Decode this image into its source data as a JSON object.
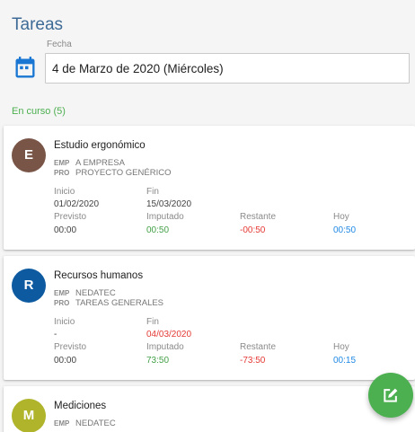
{
  "header": {
    "title": "Tareas"
  },
  "date_picker": {
    "label": "Fecha",
    "value": "4 de Marzo de 2020 (Miércoles)"
  },
  "section": {
    "label": "En curso (5)"
  },
  "labels": {
    "emp": "EMP",
    "pro": "PRO",
    "start": "Inicio",
    "end": "Fin",
    "planned": "Previsto",
    "charged": "Imputado",
    "remaining": "Restante",
    "today": "Hoy"
  },
  "tasks": [
    {
      "initial": "E",
      "avatar_color": "#795548",
      "title": "Estudio ergonómico",
      "company": "A EMPRESA",
      "project": "PROYECTO GENÉRICO",
      "start": "01/02/2020",
      "end": "15/03/2020",
      "planned": "00:00",
      "charged": "00:50",
      "remaining": "-00:50",
      "today": "00:50"
    },
    {
      "initial": "R",
      "avatar_color": "#0d5aa0",
      "title": "Recursos humanos",
      "company": "NEDATEC",
      "project": "TAREAS GENERALES",
      "start": "-",
      "end": "04/03/2020",
      "planned": "00:00",
      "charged": "73:50",
      "remaining": "-73:50",
      "today": "00:15"
    },
    {
      "initial": "M",
      "avatar_color": "#afb42b",
      "title": "Mediciones",
      "company": "NEDATEC"
    }
  ],
  "colors": {
    "accent": "#4caf50",
    "title": "#3d6a96",
    "negative": "#e53935",
    "today": "#1e88e5"
  },
  "icons": {
    "calendar": "calendar-icon",
    "fab": "edit-icon"
  }
}
